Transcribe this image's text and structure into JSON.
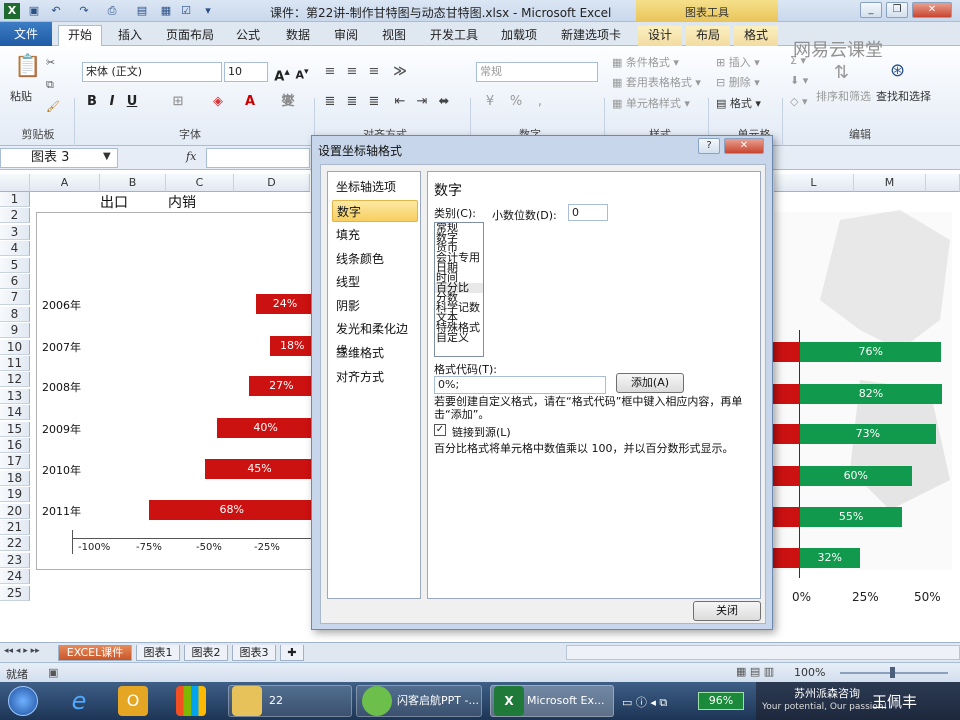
{
  "titlebar": {
    "title": "课件：第22讲-制作甘特图与动态甘特图.xlsx - Microsoft Excel",
    "context_tab": "图表工具"
  },
  "tabs": [
    "文件",
    "开始",
    "插入",
    "页面布局",
    "公式",
    "数据",
    "审阅",
    "视图",
    "开发工具",
    "加载项",
    "新建选项卡",
    "设计",
    "布局",
    "格式"
  ],
  "ribbon": {
    "clipboard": {
      "paste": "粘贴",
      "group": "剪贴板"
    },
    "font": {
      "name": "宋体 (正文)",
      "size": "10",
      "group": "字体"
    },
    "alignment": {
      "group": "对齐方式"
    },
    "number": {
      "format": "常规",
      "group": "数字"
    },
    "styles": {
      "conditional": "条件格式",
      "table": "套用表格格式",
      "cell": "单元格样式",
      "group": "样式"
    },
    "cells": {
      "insert": "插入",
      "delete": "删除",
      "format": "格式",
      "group": "单元格"
    },
    "editing": {
      "sort": "排序和筛选",
      "find": "查找和选择",
      "group": "编辑"
    },
    "watermark": "网易云课堂"
  },
  "formula_bar": {
    "name_box": "图表 3",
    "fx": "fx"
  },
  "columns": [
    "A",
    "B",
    "C",
    "D",
    "L",
    "M"
  ],
  "cells": {
    "b1": "出口",
    "c1": "内销"
  },
  "rows": [
    "1",
    "2",
    "3",
    "4",
    "5",
    "6",
    "7",
    "8",
    "9",
    "10",
    "11",
    "12",
    "13",
    "14",
    "15",
    "16",
    "17",
    "18",
    "19",
    "20",
    "21",
    "22",
    "23",
    "24",
    "25"
  ],
  "chart_data": {
    "type": "bar",
    "categories": [
      "2006年",
      "2007年",
      "2008年",
      "2009年",
      "2010年",
      "2011年"
    ],
    "series": [
      {
        "name": "出口",
        "values": [
          -24,
          -18,
          -27,
          -40,
          -45,
          -68
        ],
        "labels": [
          "24%",
          "18%",
          "27%",
          "40%",
          "45%",
          "68%"
        ],
        "color": "#cc1111"
      },
      {
        "name": "内销",
        "values": [
          76,
          82,
          73,
          60,
          55,
          32
        ],
        "labels": [
          "76%",
          "82%",
          "73%",
          "60%",
          "55%",
          "32%"
        ],
        "color": "#11994d"
      }
    ],
    "left_ticks": [
      "-100%",
      "-75%",
      "-50%",
      "-25%"
    ],
    "right_ticks": [
      "0%",
      "25%",
      "50%"
    ],
    "xlim": [
      -100,
      50
    ]
  },
  "dialog": {
    "title": "设置坐标轴格式",
    "help": "?",
    "close": "✕",
    "nav": [
      "坐标轴选项",
      "数字",
      "填充",
      "线条颜色",
      "线型",
      "阴影",
      "发光和柔化边缘",
      "三维格式",
      "对齐方式"
    ],
    "selected_nav": "数字",
    "heading": "数字",
    "category_label": "类别(C):",
    "categories": [
      "常规",
      "数字",
      "货币",
      "会计专用",
      "日期",
      "时间",
      "百分比",
      "分数",
      "科学记数",
      "文本",
      "特殊格式",
      "自定义"
    ],
    "selected_category": "百分比",
    "decimals_label": "小数位数(D):",
    "decimals_value": "0",
    "format_code_label": "格式代码(T):",
    "format_code_value": "0%;",
    "add_button": "添加(A)",
    "hint": "若要创建自定义格式，请在“格式代码”框中键入相应内容，再单击“添加”。",
    "link_label": "链接到源(L)",
    "description": "百分比格式将单元格中数值乘以 100，并以百分数形式显示。",
    "close_button": "关闭"
  },
  "sheet_tabs": [
    "EXCEL课件",
    "图表1",
    "图表2",
    "图表3"
  ],
  "status": {
    "ready": "就绪",
    "zoom": "100%"
  },
  "taskbar": {
    "folder": "22",
    "app1": "闪客启航PPT -...",
    "app2": "Microsoft Ex...",
    "battery": "96%",
    "brand": "苏州派森咨询",
    "slogan": "Your potential, Our passion!",
    "presenter": "王佩丰"
  }
}
